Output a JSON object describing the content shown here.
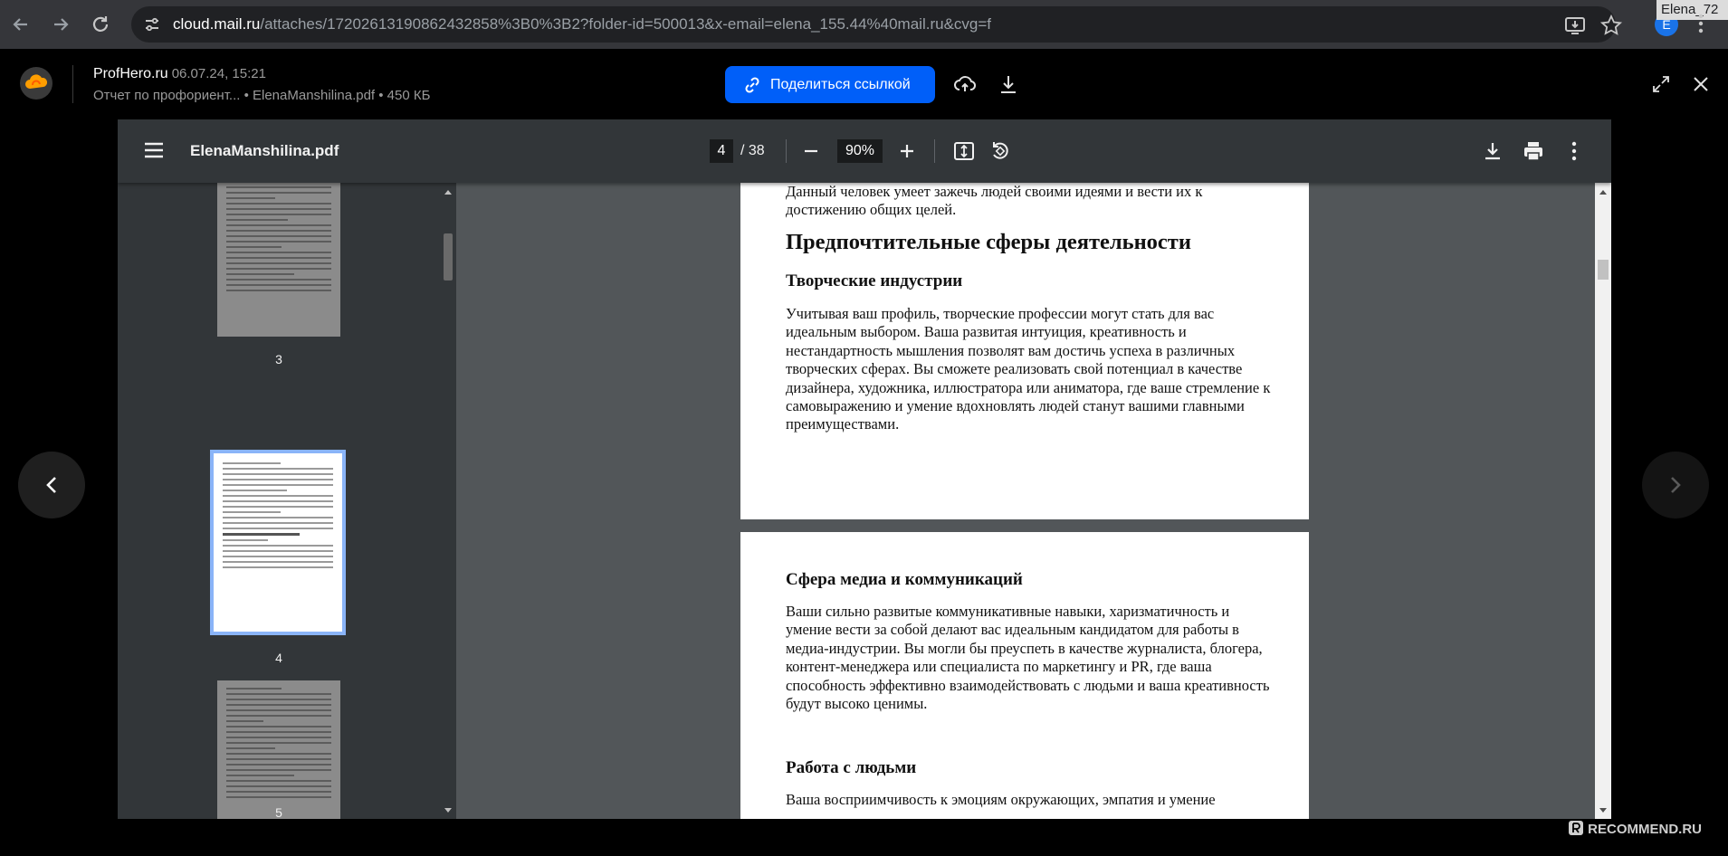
{
  "browser": {
    "url_host": "cloud.mail.ru",
    "url_path": "/attaches/17202613190862432858%3B0%3B2?folder-id=500013&x-email=elena_155.44%40mail.ru&cvg=f",
    "profile_letter": "E",
    "profile_name": "Elena_72"
  },
  "header": {
    "owner": "ProfHero.ru",
    "date": "06.07.24, 15:21",
    "meta": "Отчет по профориент...  • ElenaManshilina.pdf • 450 КБ",
    "share_label": "Поделиться ссылкой"
  },
  "viewer": {
    "filename": "ElenaManshilina.pdf",
    "current_page": "4",
    "total_pages": "/ 38",
    "zoom": "90%",
    "thumbnails": [
      {
        "label": "3"
      },
      {
        "label": "4"
      },
      {
        "label": "5"
      }
    ],
    "page4": {
      "intro": "Данный человек умеет зажечь людей своими идеями и вести их к достижению общих целей.",
      "heading": "Предпочтительные сферы деятельности",
      "subheading": "Творческие индустрии",
      "paragraph": "Учитывая ваш профиль, творческие профессии могут стать для вас идеальным выбором. Ваша развитая интуиция, креативность и нестандартность мышления позволят вам достичь успеха в различных творческих сферах. Вы сможете реализовать свой потенциал в качестве дизайнера, художника, иллюстратора или аниматора, где ваше стремление к самовыражению и умение вдохновлять людей станут вашими главными преимуществами."
    },
    "page5": {
      "subheading1": "Сфера медиа и коммуникаций",
      "paragraph1": "Ваши сильно развитые коммуникативные навыки, харизматичность и умение вести за собой делают вас идеальным кандидатом для работы в медиа-индустрии. Вы могли бы преуспеть в качестве журналиста, блогера, контент-менеджера или специалиста по маркетингу и PR, где ваша способность эффективно взаимодействовать с людьми и ваша креативность будут высоко ценимы.",
      "subheading2": "Работа с людьми",
      "paragraph2": "Ваша восприимчивость к эмоциям окружающих, эмпатия и умение"
    }
  },
  "watermark": "RECOMMEND.RU",
  "colors": {
    "accent": "#005ff9",
    "thumb_highlight": "#8ab4f8",
    "toolbar": "#323639",
    "viewer_bg": "#525659"
  }
}
